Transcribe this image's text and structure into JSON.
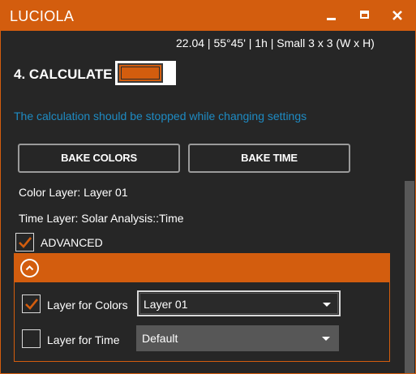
{
  "window": {
    "title": "LUCIOLA",
    "minimize_icon": "minimize-icon",
    "maximize_icon": "maximize-icon",
    "close_icon": "close-icon",
    "accent_color": "#d35d0e"
  },
  "info": {
    "summary": "22.04 | 55°45' | 1h | Small 3 x 3  (W x H)"
  },
  "calculate": {
    "label": "4. CALCULATE",
    "toggle_on": true
  },
  "warning": {
    "text": "The calculation should be stopped while changing settings",
    "color": "#1e8bc3"
  },
  "buttons": {
    "bake_colors": "BAKE COLORS",
    "bake_time": "BAKE TIME"
  },
  "layers": {
    "color_layer": "Color Layer: Layer 01",
    "time_layer": "Time Layer: Solar Analysis::Time"
  },
  "advanced": {
    "label": "ADVANCED",
    "checked": true,
    "collapse_icon": "chevron-up-icon",
    "layer_for_colors": {
      "label": "Layer for Colors",
      "checked": true,
      "selected": "Layer 01"
    },
    "layer_for_time": {
      "label": "Layer for Time",
      "checked": false,
      "selected": "Default"
    }
  }
}
